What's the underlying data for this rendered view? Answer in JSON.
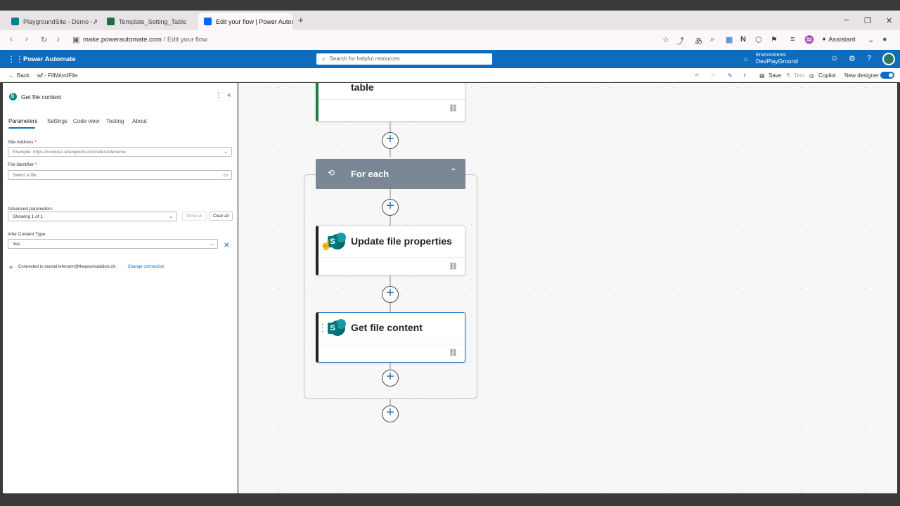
{
  "browser": {
    "tabs": [
      {
        "label": "PlaygroundSite - Demo - All I",
        "active": false
      },
      {
        "label": "Template_Setting_Table",
        "active": false
      },
      {
        "label": "Edit your flow | Power Autom",
        "active": true
      }
    ],
    "new_tab": "+",
    "url_domain": "make.powerautomate.com",
    "url_path": " / Edit your flow",
    "assistant_label": "Assistant"
  },
  "app": {
    "name": "Power Automate",
    "search_placeholder": "Search for helpful resources",
    "env_label": "Environments",
    "env_name": "DevPlayGround"
  },
  "toolbar": {
    "back": "Back",
    "flow_name": "wf - FillWordFile",
    "save": "Save",
    "test": "Test",
    "copilot": "Copilot",
    "new_designer": "New designer"
  },
  "panel": {
    "title": "Get file content",
    "tabs": [
      "Parameters",
      "Settings",
      "Code view",
      "Testing",
      "About"
    ],
    "site_address_label": "Site Address",
    "site_address_placeholder": "Example: https://contoso.sharepoint.com/sites/sitename.",
    "file_identifier_label": "File Identifier",
    "file_identifier_placeholder": "Select a file.",
    "advanced_label": "Advanced parameters",
    "advanced_value": "Showing 1 of 1",
    "show_all": "Show all",
    "clear_all": "Clear all",
    "infer_label": "Infer Content Type",
    "infer_value": "Yes",
    "connection_text": "Connected to marcel.lehmann@thepoweraddicts.ch.",
    "change_connection": "Change connection",
    "required_mark": "*"
  },
  "canvas": {
    "top_card_title": "table",
    "foreach_title": "For each",
    "card1_title": "Update file properties",
    "card2_title": "Get file content"
  }
}
